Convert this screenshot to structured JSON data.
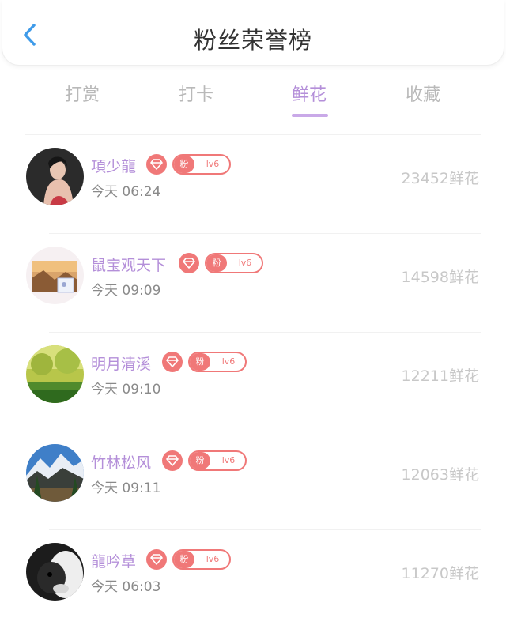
{
  "header": {
    "title": "粉丝荣誉榜",
    "back_icon": "chevron-left-icon"
  },
  "tabs": [
    {
      "label": "打赏"
    },
    {
      "label": "打卡"
    },
    {
      "label": "鲜花",
      "active": true
    },
    {
      "label": "收藏"
    }
  ],
  "fan_badge": {
    "label": "粉",
    "level": "lv6"
  },
  "icons": {
    "gem": "diamond-icon"
  },
  "colors": {
    "accent": "#b48fd9",
    "badge": "#f07878",
    "muted_text": "#8a8a8a",
    "count_text": "#c8c8c8"
  },
  "fans": [
    {
      "name": "項少龍",
      "time": "今天 06:24",
      "count": "23452鲜花"
    },
    {
      "name": "鼠宝观天下",
      "time": "今天 09:09",
      "count": "14598鲜花"
    },
    {
      "name": "明月清溪",
      "time": "今天 09:10",
      "count": "12211鲜花"
    },
    {
      "name": "竹林松风",
      "time": "今天 09:11",
      "count": "12063鲜花"
    },
    {
      "name": "龍吟草",
      "time": "今天 06:03",
      "count": "11270鲜花"
    }
  ]
}
